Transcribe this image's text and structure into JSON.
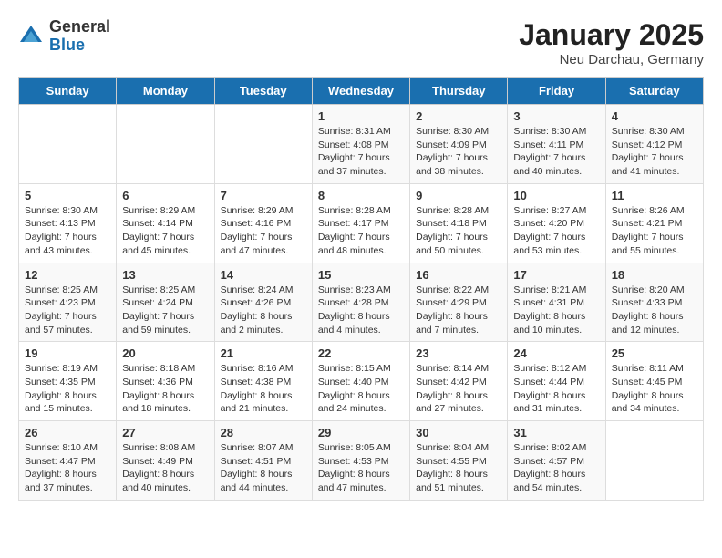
{
  "logo": {
    "general": "General",
    "blue": "Blue"
  },
  "title": "January 2025",
  "location": "Neu Darchau, Germany",
  "weekdays": [
    "Sunday",
    "Monday",
    "Tuesday",
    "Wednesday",
    "Thursday",
    "Friday",
    "Saturday"
  ],
  "weeks": [
    [
      {
        "day": "",
        "info": ""
      },
      {
        "day": "",
        "info": ""
      },
      {
        "day": "",
        "info": ""
      },
      {
        "day": "1",
        "info": "Sunrise: 8:31 AM\nSunset: 4:08 PM\nDaylight: 7 hours\nand 37 minutes."
      },
      {
        "day": "2",
        "info": "Sunrise: 8:30 AM\nSunset: 4:09 PM\nDaylight: 7 hours\nand 38 minutes."
      },
      {
        "day": "3",
        "info": "Sunrise: 8:30 AM\nSunset: 4:11 PM\nDaylight: 7 hours\nand 40 minutes."
      },
      {
        "day": "4",
        "info": "Sunrise: 8:30 AM\nSunset: 4:12 PM\nDaylight: 7 hours\nand 41 minutes."
      }
    ],
    [
      {
        "day": "5",
        "info": "Sunrise: 8:30 AM\nSunset: 4:13 PM\nDaylight: 7 hours\nand 43 minutes."
      },
      {
        "day": "6",
        "info": "Sunrise: 8:29 AM\nSunset: 4:14 PM\nDaylight: 7 hours\nand 45 minutes."
      },
      {
        "day": "7",
        "info": "Sunrise: 8:29 AM\nSunset: 4:16 PM\nDaylight: 7 hours\nand 47 minutes."
      },
      {
        "day": "8",
        "info": "Sunrise: 8:28 AM\nSunset: 4:17 PM\nDaylight: 7 hours\nand 48 minutes."
      },
      {
        "day": "9",
        "info": "Sunrise: 8:28 AM\nSunset: 4:18 PM\nDaylight: 7 hours\nand 50 minutes."
      },
      {
        "day": "10",
        "info": "Sunrise: 8:27 AM\nSunset: 4:20 PM\nDaylight: 7 hours\nand 53 minutes."
      },
      {
        "day": "11",
        "info": "Sunrise: 8:26 AM\nSunset: 4:21 PM\nDaylight: 7 hours\nand 55 minutes."
      }
    ],
    [
      {
        "day": "12",
        "info": "Sunrise: 8:25 AM\nSunset: 4:23 PM\nDaylight: 7 hours\nand 57 minutes."
      },
      {
        "day": "13",
        "info": "Sunrise: 8:25 AM\nSunset: 4:24 PM\nDaylight: 7 hours\nand 59 minutes."
      },
      {
        "day": "14",
        "info": "Sunrise: 8:24 AM\nSunset: 4:26 PM\nDaylight: 8 hours\nand 2 minutes."
      },
      {
        "day": "15",
        "info": "Sunrise: 8:23 AM\nSunset: 4:28 PM\nDaylight: 8 hours\nand 4 minutes."
      },
      {
        "day": "16",
        "info": "Sunrise: 8:22 AM\nSunset: 4:29 PM\nDaylight: 8 hours\nand 7 minutes."
      },
      {
        "day": "17",
        "info": "Sunrise: 8:21 AM\nSunset: 4:31 PM\nDaylight: 8 hours\nand 10 minutes."
      },
      {
        "day": "18",
        "info": "Sunrise: 8:20 AM\nSunset: 4:33 PM\nDaylight: 8 hours\nand 12 minutes."
      }
    ],
    [
      {
        "day": "19",
        "info": "Sunrise: 8:19 AM\nSunset: 4:35 PM\nDaylight: 8 hours\nand 15 minutes."
      },
      {
        "day": "20",
        "info": "Sunrise: 8:18 AM\nSunset: 4:36 PM\nDaylight: 8 hours\nand 18 minutes."
      },
      {
        "day": "21",
        "info": "Sunrise: 8:16 AM\nSunset: 4:38 PM\nDaylight: 8 hours\nand 21 minutes."
      },
      {
        "day": "22",
        "info": "Sunrise: 8:15 AM\nSunset: 4:40 PM\nDaylight: 8 hours\nand 24 minutes."
      },
      {
        "day": "23",
        "info": "Sunrise: 8:14 AM\nSunset: 4:42 PM\nDaylight: 8 hours\nand 27 minutes."
      },
      {
        "day": "24",
        "info": "Sunrise: 8:12 AM\nSunset: 4:44 PM\nDaylight: 8 hours\nand 31 minutes."
      },
      {
        "day": "25",
        "info": "Sunrise: 8:11 AM\nSunset: 4:45 PM\nDaylight: 8 hours\nand 34 minutes."
      }
    ],
    [
      {
        "day": "26",
        "info": "Sunrise: 8:10 AM\nSunset: 4:47 PM\nDaylight: 8 hours\nand 37 minutes."
      },
      {
        "day": "27",
        "info": "Sunrise: 8:08 AM\nSunset: 4:49 PM\nDaylight: 8 hours\nand 40 minutes."
      },
      {
        "day": "28",
        "info": "Sunrise: 8:07 AM\nSunset: 4:51 PM\nDaylight: 8 hours\nand 44 minutes."
      },
      {
        "day": "29",
        "info": "Sunrise: 8:05 AM\nSunset: 4:53 PM\nDaylight: 8 hours\nand 47 minutes."
      },
      {
        "day": "30",
        "info": "Sunrise: 8:04 AM\nSunset: 4:55 PM\nDaylight: 8 hours\nand 51 minutes."
      },
      {
        "day": "31",
        "info": "Sunrise: 8:02 AM\nSunset: 4:57 PM\nDaylight: 8 hours\nand 54 minutes."
      },
      {
        "day": "",
        "info": ""
      }
    ]
  ]
}
